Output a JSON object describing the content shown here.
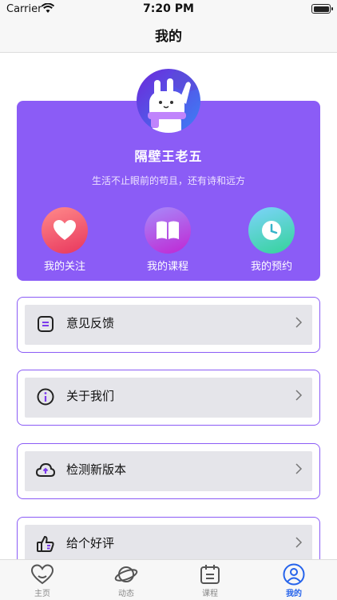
{
  "status_bar": {
    "carrier": "Carrier",
    "time": "7:20 PM"
  },
  "nav": {
    "title": "我的"
  },
  "profile": {
    "username": "隔壁王老五",
    "motto": "生活不止眼前的苟且，还有诗和远方",
    "quick_actions": [
      {
        "label": "我的关注",
        "icon": "heart-icon"
      },
      {
        "label": "我的课程",
        "icon": "book-icon"
      },
      {
        "label": "我的预约",
        "icon": "clock-icon"
      }
    ]
  },
  "menu": [
    {
      "label": "意见反馈",
      "icon": "feedback-icon"
    },
    {
      "label": "关于我们",
      "icon": "info-icon"
    },
    {
      "label": "检测新版本",
      "icon": "cloud-upload-icon"
    },
    {
      "label": "给个好评",
      "icon": "thumbs-up-icon"
    }
  ],
  "tabs": [
    {
      "label": "主页",
      "icon": "home-heart-icon",
      "active": false
    },
    {
      "label": "动态",
      "icon": "planet-icon",
      "active": false
    },
    {
      "label": "课程",
      "icon": "calendar-icon",
      "active": false
    },
    {
      "label": "我的",
      "icon": "user-icon",
      "active": true
    }
  ],
  "colors": {
    "accent": "#8b5cf6",
    "tab_active": "#2563eb"
  }
}
